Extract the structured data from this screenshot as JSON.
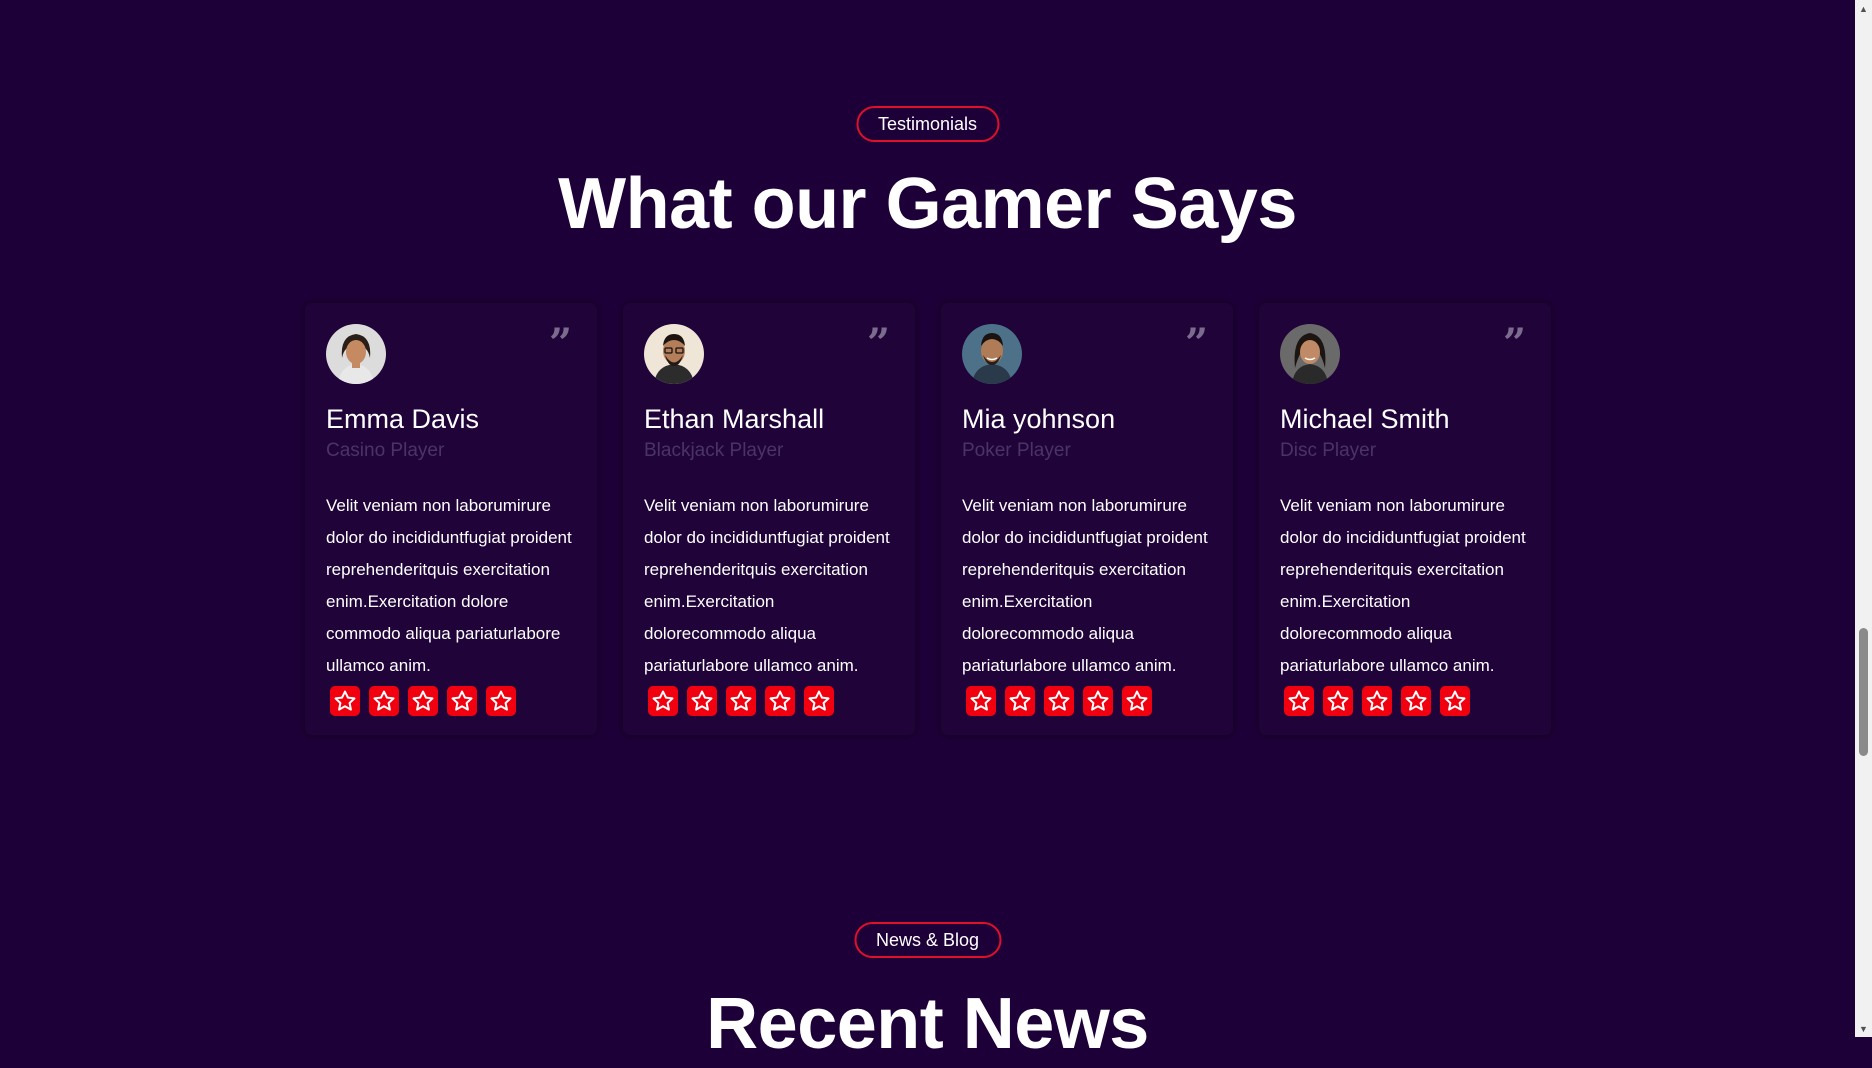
{
  "testimonials": {
    "badge": "Testimonials",
    "title": "What our Gamer Says",
    "cards": [
      {
        "name": "Emma Davis",
        "role": "Casino Player",
        "text": "Velit veniam non laborumirure dolor do incididuntfugiat proident reprehenderitquis exercitation enim.Exercitation dolore commodo aliqua pariaturlabore ullamco anim.",
        "rating": 5
      },
      {
        "name": "Ethan Marshall",
        "role": "Blackjack Player",
        "text": "Velit veniam non laborumirure dolor do incididuntfugiat proident reprehenderitquis exercitation enim.Exercitation dolorecommodo aliqua pariaturlabore ullamco anim.",
        "rating": 5
      },
      {
        "name": "Mia yohnson",
        "role": "Poker Player",
        "text": "Velit veniam non laborumirure dolor do incididuntfugiat proident reprehenderitquis exercitation enim.Exercitation dolorecommodo aliqua pariaturlabore ullamco anim.",
        "rating": 5
      },
      {
        "name": "Michael Smith",
        "role": "Disc Player",
        "text": "Velit veniam non laborumirure dolor do incididuntfugiat proident reprehenderitquis exercitation enim.Exercitation dolorecommodo aliqua pariaturlabore ullamco anim.",
        "rating": 5
      }
    ]
  },
  "news": {
    "badge": "News & Blog",
    "title": "Recent News"
  },
  "colors": {
    "background": "#1e0038",
    "accent": "#e0102a",
    "star": "#f1000f",
    "muted": "#4a3466"
  },
  "icons": {
    "quote": "quote-icon",
    "star": "star-icon"
  }
}
